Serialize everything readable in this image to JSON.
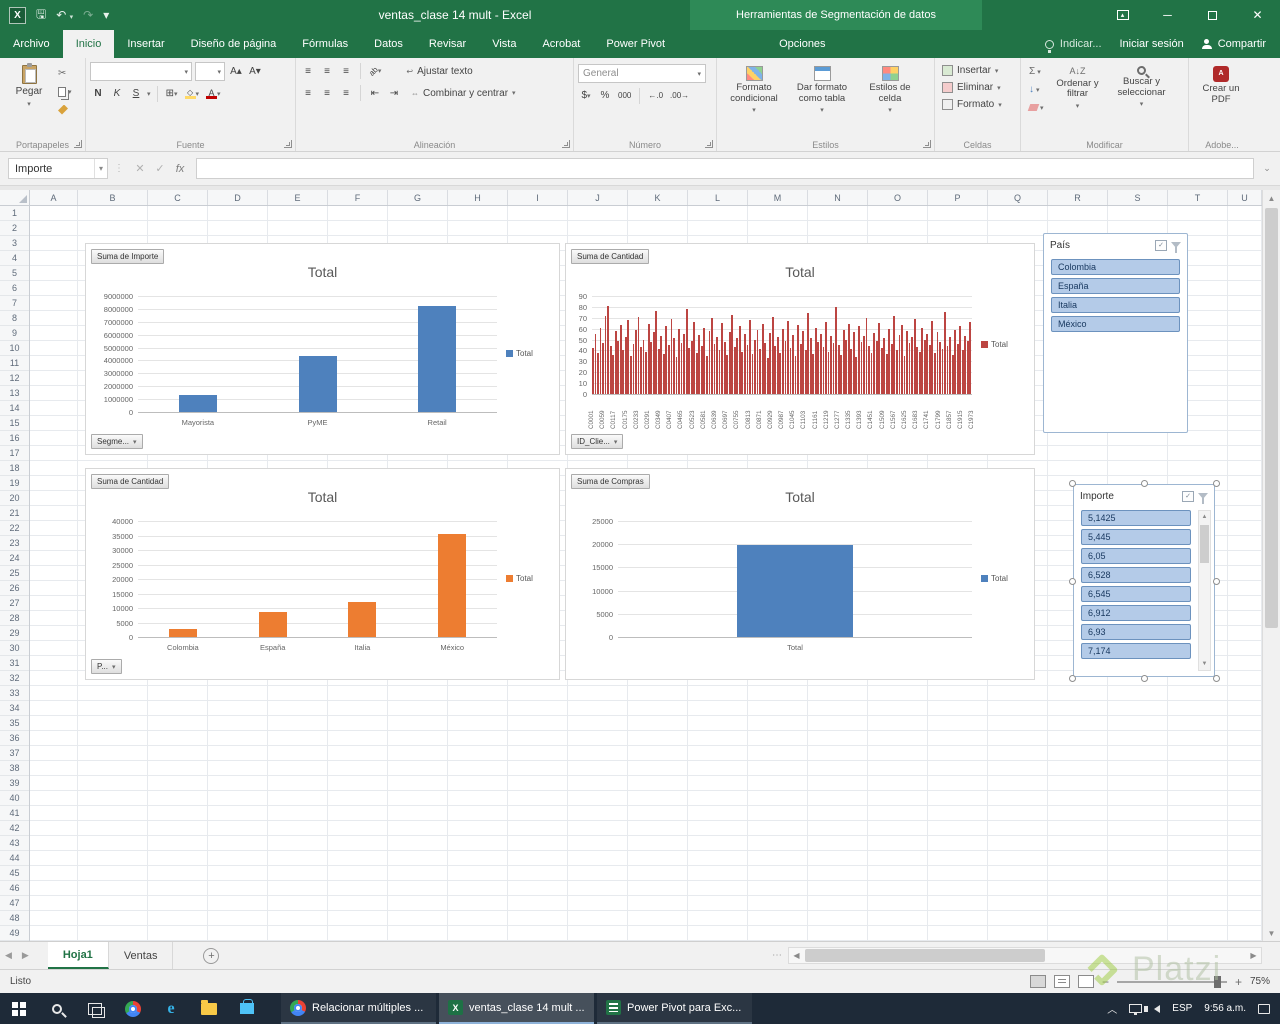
{
  "titlebar": {
    "title": "ventas_clase 14 mult - Excel",
    "contextual_title": "Herramientas de Segmentación de datos"
  },
  "tabs": {
    "items": [
      "Archivo",
      "Inicio",
      "Insertar",
      "Diseño de página",
      "Fórmulas",
      "Datos",
      "Revisar",
      "Vista",
      "Acrobat",
      "Power Pivot"
    ],
    "active": "Inicio",
    "contextual": "Opciones",
    "tell_me": "Indicar...",
    "sign_in": "Iniciar sesión",
    "share": "Compartir"
  },
  "ribbon": {
    "groups": [
      {
        "label": "Portapapeles"
      },
      {
        "label": "Fuente"
      },
      {
        "label": "Alineación"
      },
      {
        "label": "Número"
      },
      {
        "label": "Estilos"
      },
      {
        "label": "Celdas"
      },
      {
        "label": "Modificar"
      },
      {
        "label": "Adobe..."
      }
    ],
    "portapapeles": {
      "pegar": "Pegar"
    },
    "fuente": {
      "bold": "N",
      "italic": "K",
      "underline": "S"
    },
    "alineacion": {
      "ajustar": "Ajustar texto",
      "combinar": "Combinar y centrar"
    },
    "numero": {
      "formato": "General",
      "moneda": "$",
      "porcentaje": "%",
      "millares": "000"
    },
    "estilos": {
      "condicional": "Formato condicional",
      "tabla": "Dar formato como tabla",
      "celda": "Estilos de celda"
    },
    "celdas": {
      "insertar": "Insertar",
      "eliminar": "Eliminar",
      "formato": "Formato"
    },
    "modificar": {
      "ordenar": "Ordenar y filtrar",
      "buscar": "Buscar y seleccionar"
    },
    "adobe": {
      "crear_pdf": "Crear un PDF"
    }
  },
  "formula_bar": {
    "name_box": "Importe",
    "fx": "fx"
  },
  "grid": {
    "columns": [
      "A",
      "B",
      "C",
      "D",
      "E",
      "F",
      "G",
      "H",
      "I",
      "J",
      "K",
      "L",
      "M",
      "N",
      "O",
      "P",
      "Q",
      "R",
      "S",
      "T",
      "U"
    ],
    "row_count": 49
  },
  "chart_data": [
    {
      "type": "bar",
      "id": "suma-importe-por-segmento",
      "field_button": "Suma de Importe",
      "axis_button": "Segme...",
      "title": "Total",
      "legend": "Total",
      "color": "#4e81bd",
      "categories": [
        "Mayorista",
        "PyME",
        "Retail"
      ],
      "values": [
        1300000,
        4350000,
        8200000
      ],
      "ylim": [
        0,
        9000000
      ],
      "ytick_step": 1000000,
      "grid": true,
      "legend_position": "right"
    },
    {
      "type": "bar",
      "id": "suma-cantidad-por-cliente",
      "field_button": "Suma de Cantidad",
      "axis_button": "ID_Clie...",
      "title": "Total",
      "legend": "Total",
      "color": "#bc4542",
      "dense": true,
      "x_tick_labels": [
        "C0001",
        "C0059",
        "C0117",
        "C0175",
        "C0233",
        "C0291",
        "C0349",
        "C0407",
        "C0465",
        "C0523",
        "C0581",
        "C0639",
        "C0697",
        "C0755",
        "C0813",
        "C0871",
        "C0929",
        "C0987",
        "C1045",
        "C1103",
        "C1161",
        "C1219",
        "C1277",
        "C1335",
        "C1393",
        "C1451",
        "C1509",
        "C1567",
        "C1625",
        "C1683",
        "C1741",
        "C1799",
        "C1857",
        "C1915",
        "C1973"
      ],
      "values": [
        42,
        55,
        38,
        61,
        47,
        72,
        81,
        44,
        36,
        58,
        49,
        63,
        40,
        52,
        68,
        35,
        46,
        59,
        71,
        43,
        50,
        39,
        64,
        48,
        57,
        76,
        41,
        53,
        37,
        62,
        45,
        69,
        51,
        34,
        60,
        47,
        55,
        78,
        42,
        49,
        66,
        38,
        54,
        44,
        61,
        35,
        58,
        70,
        46,
        52,
        40,
        65,
        48,
        36,
        57,
        73,
        43,
        51,
        62,
        39,
        55,
        45,
        68,
        37,
        50,
        59,
        41,
        64,
        47,
        33,
        56,
        71,
        44,
        52,
        38,
        60,
        49,
        67,
        42,
        54,
        35,
        63,
        46,
        58,
        40,
        74,
        51,
        37,
        61,
        48,
        55,
        43,
        66,
        39,
        53,
        47,
        80,
        45,
        36,
        59,
        50,
        64,
        41,
        57,
        34,
        62,
        48,
        53,
        70,
        44,
        38,
        56,
        49,
        65,
        42,
        51,
        37,
        60,
        46,
        72,
        40,
        54,
        63,
        35,
        58,
        47,
        52,
        69,
        43,
        39,
        61,
        50,
        55,
        45,
        67,
        38,
        57,
        48,
        41,
        75,
        44,
        52,
        36,
        59,
        46,
        62,
        40,
        53,
        49,
        66
      ],
      "ylim": [
        0,
        90
      ],
      "ytick_step": 10,
      "grid": true,
      "legend_position": "right"
    },
    {
      "type": "bar",
      "id": "suma-cantidad-por-pais",
      "field_button": "Suma de Cantidad",
      "axis_button": "P...",
      "title": "Total",
      "legend": "Total",
      "color": "#ed7d31",
      "categories": [
        "Colombia",
        "España",
        "Italia",
        "México"
      ],
      "values": [
        2800,
        8500,
        12000,
        35500
      ],
      "ylim": [
        0,
        40000
      ],
      "ytick_step": 5000,
      "grid": true,
      "legend_position": "right"
    },
    {
      "type": "bar",
      "id": "suma-compras-total",
      "field_button": "Suma de Compras",
      "axis_button": null,
      "title": "Total",
      "legend": "Total",
      "color": "#4e81bd",
      "categories": [
        "Total"
      ],
      "values": [
        19900
      ],
      "ylim": [
        0,
        25000
      ],
      "ytick_step": 5000,
      "grid": true,
      "legend_position": "right"
    }
  ],
  "slicers": [
    {
      "title": "País",
      "items": [
        "Colombia",
        "España",
        "Italia",
        "México"
      ],
      "all_selected": true,
      "scrollbar": false,
      "selected_object": false
    },
    {
      "title": "Importe",
      "items": [
        "5,1425",
        "5,445",
        "6,05",
        "6,528",
        "6,545",
        "6,912",
        "6,93",
        "7,174"
      ],
      "all_selected": true,
      "scrollbar": true,
      "selected_object": true
    }
  ],
  "sheet_tabs": {
    "tabs": [
      "Hoja1",
      "Ventas"
    ],
    "active": "Hoja1"
  },
  "status_bar": {
    "status": "Listo",
    "zoom": "75%"
  },
  "taskbar": {
    "windows": [
      {
        "label": "Relacionar múltiples ...",
        "icon": "chrome",
        "active": false
      },
      {
        "label": "ventas_clase 14 mult ...",
        "icon": "excel",
        "active": true
      },
      {
        "label": "Power Pivot para Exc...",
        "icon": "powerpivot",
        "active": false
      }
    ],
    "tray": {
      "language": "ESP",
      "time": "9:56 a.m."
    }
  },
  "watermark": {
    "text": "Platzi"
  }
}
